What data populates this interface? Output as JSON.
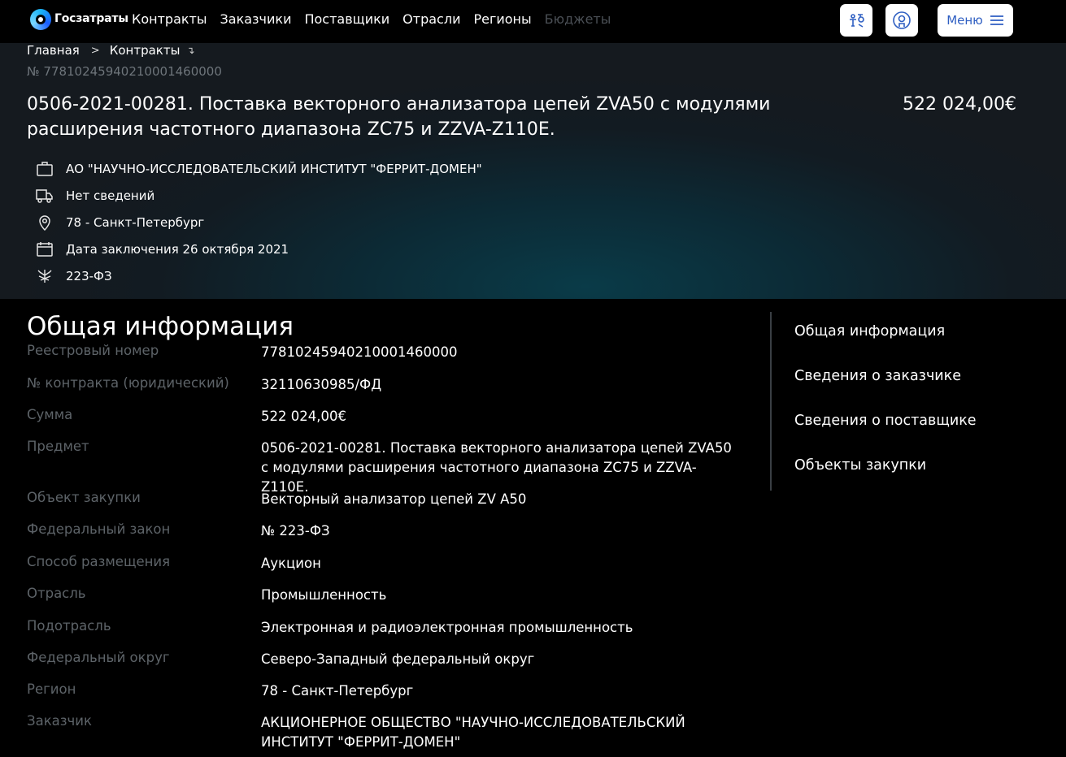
{
  "header": {
    "brand": "Госзатраты",
    "nav": [
      {
        "label": "Контракты",
        "enabled": true
      },
      {
        "label": "Заказчики",
        "enabled": true
      },
      {
        "label": "Поставщики",
        "enabled": true
      },
      {
        "label": "Отрасли",
        "enabled": true
      },
      {
        "label": "Регионы",
        "enabled": true
      },
      {
        "label": "Бюджеты",
        "enabled": false
      }
    ],
    "menu_label": "Меню",
    "accent_color": "#2f5fc2"
  },
  "breadcrumb": {
    "home": "Главная",
    "current": "Контракты"
  },
  "contract": {
    "number_label": "№ 77810245940210001460000",
    "title": "0506-2021-00281. Поставка векторного анализатора цепей ZVA50 с модулями расширения частотного диапазона ZC75 и ZZVA-Z110E.",
    "price": "522 024,00€",
    "facts": [
      {
        "icon": "briefcase-icon",
        "text": "АО \"НАУЧНО-ИССЛЕДОВАТЕЛЬСКИЙ ИНСТИТУТ \"ФЕРРИТ-ДОМЕН\""
      },
      {
        "icon": "truck-icon",
        "text": "Нет сведений"
      },
      {
        "icon": "location-pin-icon",
        "text": "78 - Санкт-Петербург"
      },
      {
        "icon": "calendar-icon",
        "text": "Дата заключения 26 октября 2021"
      },
      {
        "icon": "emblem-icon",
        "text": "223-ФЗ"
      }
    ]
  },
  "general_info": {
    "title": "Общая информация",
    "rows": [
      {
        "label": "Реестровый номер",
        "value": "77810245940210001460000"
      },
      {
        "label": "№ контракта (юридический)",
        "value": "32110630985/ФД"
      },
      {
        "label": "Сумма",
        "value": "522 024,00€"
      },
      {
        "label": "Предмет",
        "value": "0506-2021-00281. Поставка векторного анализатора цепей ZVA50 с модулями расширения частотного диапазона ZC75 и ZZVA-Z110E."
      },
      {
        "label": "Объект закупки",
        "value": "Векторный анализатор цепей ZV A50"
      },
      {
        "label": "Федеральный закон",
        "value": "№ 223-ФЗ"
      },
      {
        "label": "Способ размещения",
        "value": "Аукцион"
      },
      {
        "label": "Отрасль",
        "value": "Промышленность"
      },
      {
        "label": "Подотрасль",
        "value": "Электронная и радиоэлектронная промышленность"
      },
      {
        "label": "Федеральный округ",
        "value": "Северо-Западный федеральный округ"
      },
      {
        "label": "Регион",
        "value": "78 - Санкт-Петербург"
      },
      {
        "label": "Заказчик",
        "value": "АКЦИОНЕРНОЕ ОБЩЕСТВО \"НАУЧНО-ИССЛЕДОВАТЕЛЬСКИЙ ИНСТИТУТ \"ФЕРРИТ-ДОМЕН\""
      }
    ]
  },
  "toc": {
    "items": [
      "Общая информация",
      "Сведения о заказчике",
      "Сведения о поставщике",
      "Объекты закупки"
    ]
  }
}
